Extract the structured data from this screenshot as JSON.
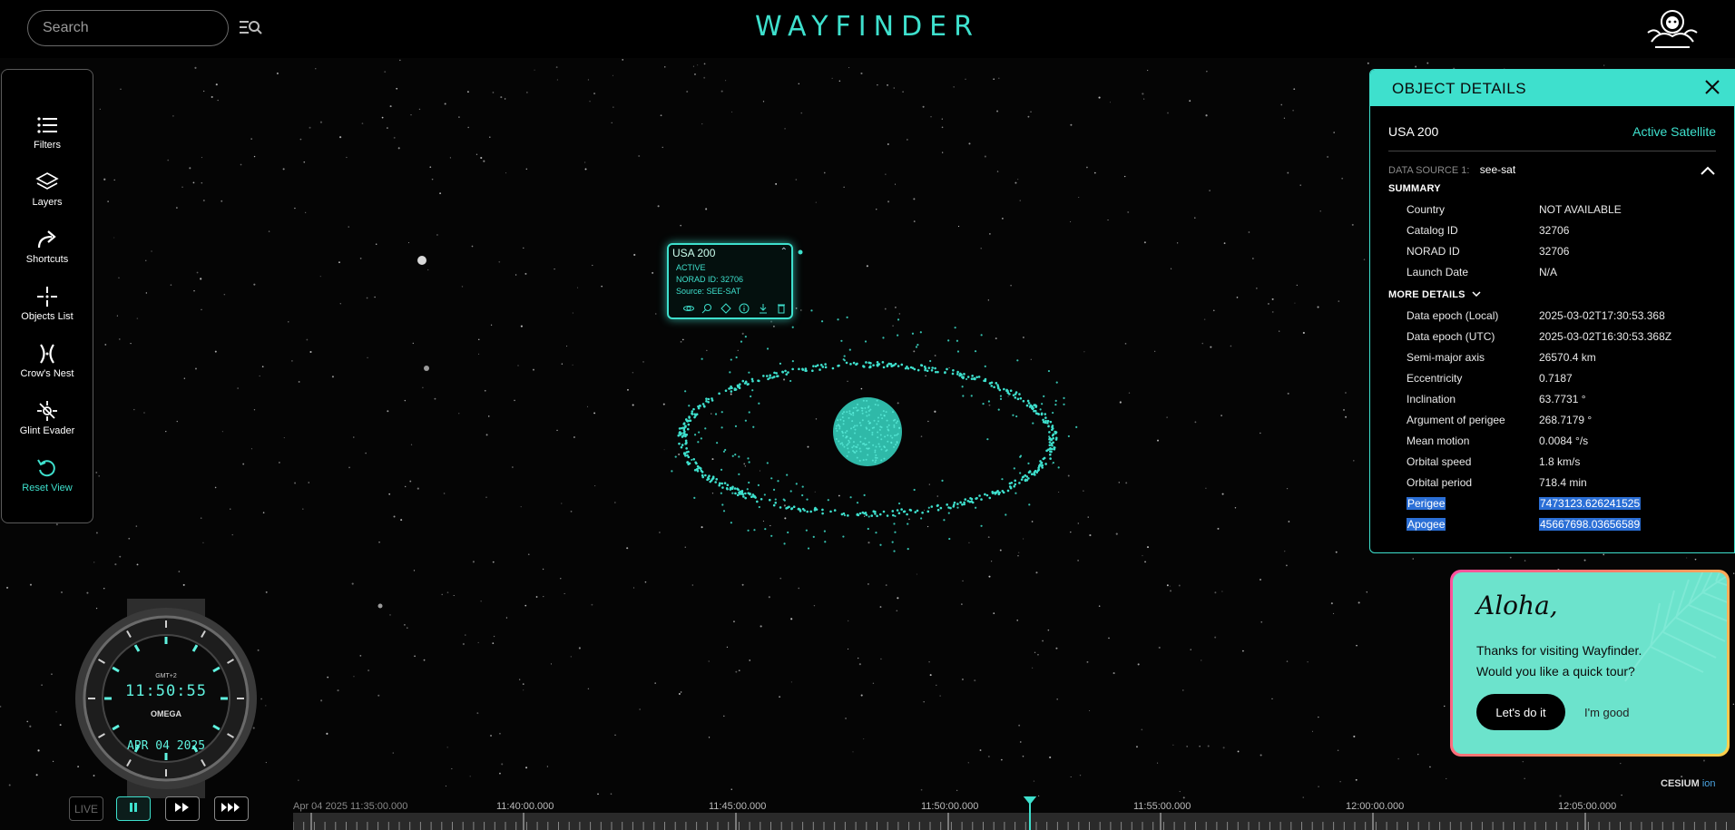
{
  "app": {
    "logo": "WAYFINDER"
  },
  "search": {
    "placeholder": "Search"
  },
  "sidebar": {
    "items": [
      {
        "label": "Filters",
        "icon": "filters-icon"
      },
      {
        "label": "Layers",
        "icon": "layers-icon"
      },
      {
        "label": "Shortcuts",
        "icon": "shortcuts-icon"
      },
      {
        "label": "Objects List",
        "icon": "objects-list-icon"
      },
      {
        "label": "Crow's Nest",
        "icon": "crows-nest-icon"
      },
      {
        "label": "Glint Evader",
        "icon": "glint-evader-icon"
      },
      {
        "label": "Reset View",
        "icon": "reset-view-icon"
      }
    ]
  },
  "popup": {
    "name": "USA 200",
    "status": "ACTIVE",
    "norad": "NORAD ID: 32706",
    "source": "Source: SEE-SAT"
  },
  "details": {
    "title": "OBJECT DETAILS",
    "object_name": "USA 200",
    "object_type": "Active Satellite",
    "data_source_label": "DATA SOURCE 1:",
    "data_source_value": "see-sat",
    "summary_title": "SUMMARY",
    "summary": [
      {
        "k": "Country",
        "v": "NOT AVAILABLE"
      },
      {
        "k": "Catalog ID",
        "v": "32706"
      },
      {
        "k": "NORAD ID",
        "v": "32706"
      },
      {
        "k": "Launch Date",
        "v": "N/A"
      }
    ],
    "more_title": "MORE DETAILS",
    "more": [
      {
        "k": "Data epoch (Local)",
        "v": "2025-03-02T17:30:53.368"
      },
      {
        "k": "Data epoch (UTC)",
        "v": "2025-03-02T16:30:53.368Z"
      },
      {
        "k": "Semi-major axis",
        "v": "26570.4 km"
      },
      {
        "k": "Eccentricity",
        "v": "0.7187"
      },
      {
        "k": "Inclination",
        "v": "63.7731 °"
      },
      {
        "k": "Argument of perigee",
        "v": "268.7179 °"
      },
      {
        "k": "Mean motion",
        "v": "0.0084 °/s"
      },
      {
        "k": "Orbital speed",
        "v": "1.8 km/s"
      },
      {
        "k": "Orbital period",
        "v": "718.4 min"
      },
      {
        "k": "Perigee",
        "v": "7473123.626241525"
      },
      {
        "k": "Apogee",
        "v": "45667698.03656589"
      }
    ]
  },
  "tour": {
    "title": "Aloha,",
    "line1": "Thanks for visiting Wayfinder.",
    "line2": "Would you like a quick tour?",
    "accept": "Let's do it",
    "decline": "I'm good"
  },
  "watch": {
    "gmt": "GMT+2",
    "time": "11:50:55",
    "brand": "OMEGA",
    "date": "APR 04 2025"
  },
  "controls": {
    "live": "LIVE"
  },
  "timeline": {
    "labels": [
      "Apr 04 2025 11:35:00.000",
      "11:40:00.000",
      "11:45:00.000",
      "11:50:00.000",
      "11:55:00.000",
      "12:00:00.000",
      "12:05:00.000"
    ]
  },
  "attribution": {
    "brand": "CESIUM",
    "suffix": "ion"
  },
  "colors": {
    "accent": "#3ee0cd",
    "selection": "#2b6fd6"
  }
}
